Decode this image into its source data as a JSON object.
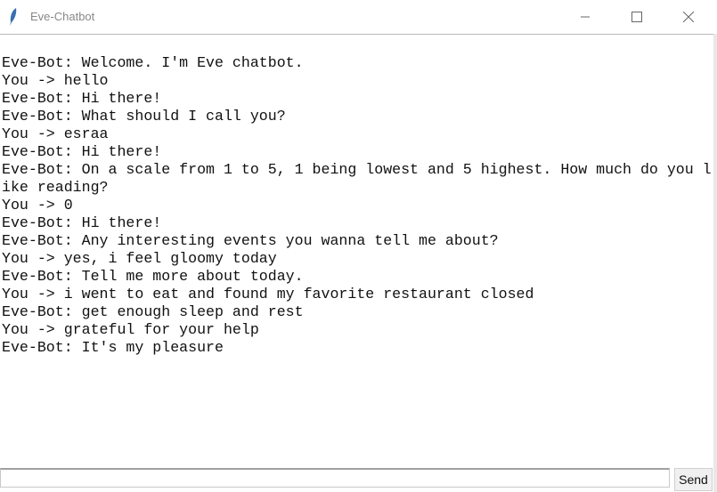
{
  "window": {
    "title": "Eve-Chatbot",
    "icon": "feather-icon"
  },
  "messages": [
    "Eve-Bot: Welcome. I'm Eve chatbot.",
    "You -> hello",
    "Eve-Bot: Hi there!",
    "Eve-Bot: What should I call you?",
    "You -> esraa",
    "Eve-Bot: Hi there!",
    "Eve-Bot: On a scale from 1 to 5, 1 being lowest and 5 highest. How much do you like reading?",
    "You -> 0",
    "Eve-Bot: Hi there!",
    "Eve-Bot: Any interesting events you wanna tell me about?",
    "You -> yes, i feel gloomy today",
    "Eve-Bot: Tell me more about today.",
    "You -> i went to eat and found my favorite restaurant closed",
    "Eve-Bot: get enough sleep and rest",
    "You -> grateful for your help",
    "Eve-Bot: It's my pleasure"
  ],
  "input": {
    "value": ""
  },
  "send_label": "Send"
}
